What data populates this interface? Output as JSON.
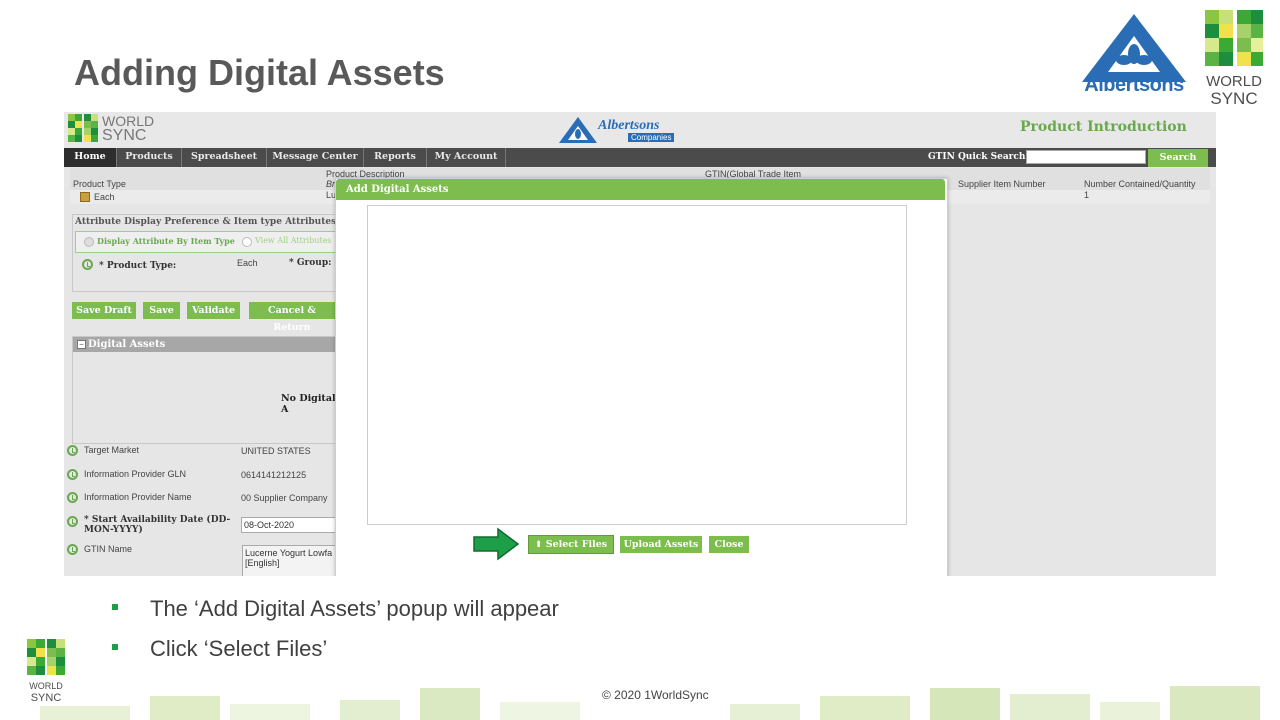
{
  "slide": {
    "title": "Adding Digital Assets",
    "bullets": [
      "The ‘Add Digital Assets’ popup will appear",
      "Click ‘Select Files’"
    ],
    "copyright": "© 2020 1WorldSync",
    "logos": {
      "albertsons": "Albertsons",
      "worldsync_line1": "WORLD",
      "worldsync_line2": "SYNC"
    },
    "colors": {
      "green_accent": "#7cbd4e",
      "bullet_green": "#1e9e48",
      "albertsons_blue": "#2a6db5"
    }
  },
  "app": {
    "header": {
      "ws_logo_line1": "WORLD",
      "ws_logo_line2": "SYNC",
      "albertsons_logo": "Albertsons",
      "albertsons_logo_sub": "Companies",
      "page_name": "Product Introduction"
    },
    "nav": {
      "items": [
        "Home",
        "Products",
        "Spreadsheet",
        "Message Center",
        "Reports",
        "My Account"
      ],
      "active": "Home",
      "gtin_label": "GTIN Quick Search:",
      "gtin_value": "",
      "search_button": "Search"
    },
    "table": {
      "col_product_type": "Product Type",
      "col_product_description": "Product Description",
      "col_product_description_sub": "Br",
      "col_gtin": "GTIN(Global Trade Item",
      "col_supplier_item": "Supplier Item Number",
      "col_number_contained": "Number Contained/Quantity",
      "row_type": "Each",
      "row_desc_fragment": "Lu",
      "row_quantity": "1"
    },
    "attributes": {
      "heading": "Attribute Display Preference & Item type Attributes",
      "radio_by_type": "Display Attribute By Item Type",
      "radio_all": "View All Attributes",
      "product_type_label": "* Product Type:",
      "product_type_value": "Each",
      "group_label": "* Group:"
    },
    "buttons": [
      "Save Draft",
      "Save",
      "Validate",
      "Cancel & Return"
    ],
    "digital_assets": {
      "heading": "Digital Assets",
      "empty_text": "No Digital A"
    },
    "fields": [
      {
        "label": "Target Market",
        "value": "UNITED STATES"
      },
      {
        "label": "Information Provider GLN",
        "value": "0614141212125"
      },
      {
        "label": "Information Provider Name",
        "value": "00 Supplier Company"
      },
      {
        "label": "* Start Availability Date (DD-MON-YYYY)",
        "value": "08-Oct-2020"
      },
      {
        "label": "GTIN Name",
        "value": "Lucerne Yogurt Lowfa\n[English]"
      }
    ],
    "modal": {
      "title": "Add Digital Assets",
      "select_files": "Select Files",
      "upload_assets": "Upload Assets",
      "close": "Close"
    }
  }
}
